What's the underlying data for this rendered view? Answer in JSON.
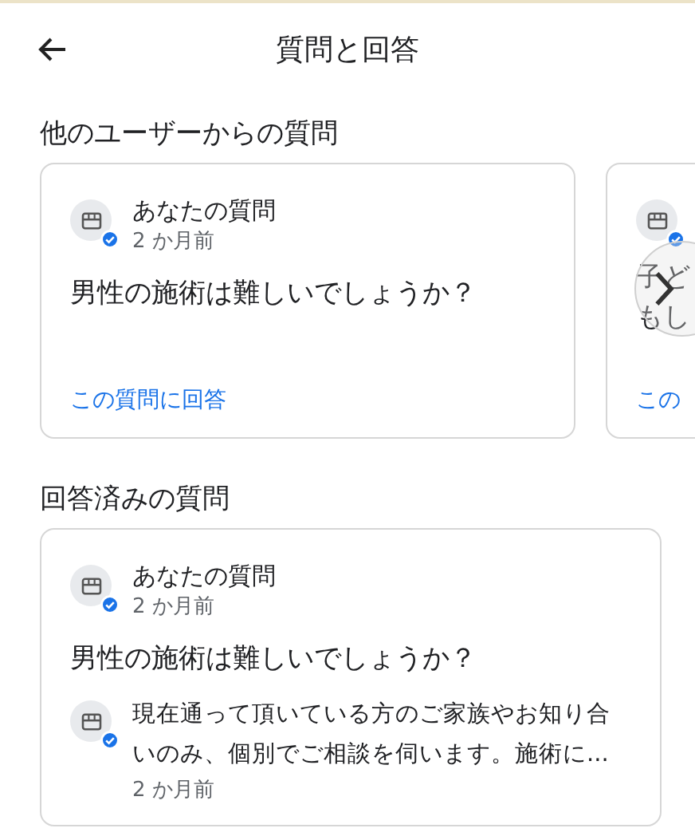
{
  "header": {
    "title": "質問と回答"
  },
  "sections": [
    {
      "kind": "carousel",
      "title": "他のユーザーからの質問",
      "cards": [
        {
          "author": "あなたの質問",
          "time": "2 か月前",
          "question_lines": [
            "男性の施術は難しいでしょうか？"
          ],
          "link": "この質問に回答"
        },
        {
          "question_lines": [
            "子ど",
            "もし"
          ],
          "link": "この"
        }
      ]
    },
    {
      "kind": "answered",
      "title": "回答済みの質問",
      "cards": [
        {
          "author": "あなたの質問",
          "time": "2 か月前",
          "question_lines": [
            "男性の施術は難しいでしょうか？"
          ],
          "answer": {
            "text": "現在通って頂いている方のご家族やお知り合いのみ、個別でご相談を伺います。施術に...",
            "time": "2 か月前"
          }
        }
      ]
    }
  ]
}
